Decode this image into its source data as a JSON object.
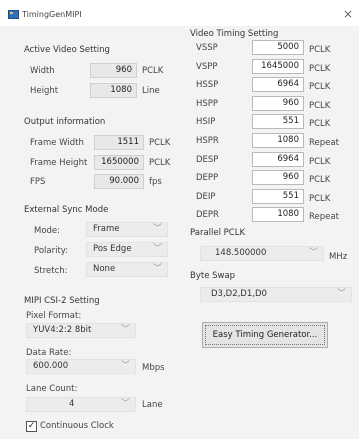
{
  "window": {
    "title": "TimingGenMIPI",
    "close_glyph": "×"
  },
  "active_video": {
    "header": "Active Video Setting",
    "width_label": "Width",
    "width_value": "960",
    "width_unit": "PCLK",
    "height_label": "Height",
    "height_value": "1080",
    "height_unit": "Line"
  },
  "output_info": {
    "header": "Output information",
    "frame_width_label": "Frame Width",
    "frame_width_value": "1511",
    "frame_width_unit": "PCLK",
    "frame_height_label": "Frame Height",
    "frame_height_value": "1650000",
    "frame_height_unit": "PCLK",
    "fps_label": "FPS",
    "fps_value": "90.000",
    "fps_unit": "fps"
  },
  "ext_sync": {
    "header": "External Sync Mode",
    "mode_label": "Mode:",
    "mode_value": "Frame",
    "polarity_label": "Polarity:",
    "polarity_value": "Pos Edge",
    "stretch_label": "Stretch:",
    "stretch_value": "None"
  },
  "mipi": {
    "header": "MIPI CSI-2 Setting",
    "pixel_format_label": "Pixel Format:",
    "pixel_format_value": "YUV4:2:2 8bit",
    "data_rate_label": "Data Rate:",
    "data_rate_value": "600.000",
    "data_rate_unit": "Mbps",
    "lane_count_label": "Lane Count:",
    "lane_count_value": "4",
    "lane_unit": "Lane",
    "continuous_clock_label": "Continuous Clock",
    "continuous_clock_checked": "✓"
  },
  "video_timing": {
    "header": "Video Timing Setting",
    "rows": [
      {
        "label": "VSSP",
        "value": "5000",
        "unit": "PCLK"
      },
      {
        "label": "VSPP",
        "value": "1645000",
        "unit": "PCLK"
      },
      {
        "label": "HSSP",
        "value": "6964",
        "unit": "PCLK"
      },
      {
        "label": "HSPP",
        "value": "960",
        "unit": "PCLK"
      },
      {
        "label": "HSIP",
        "value": "551",
        "unit": "PCLK"
      },
      {
        "label": "HSPR",
        "value": "1080",
        "unit": "Repeat"
      },
      {
        "label": "DESP",
        "value": "6964",
        "unit": "PCLK"
      },
      {
        "label": "DEPP",
        "value": "960",
        "unit": "PCLK"
      },
      {
        "label": "DEIP",
        "value": "551",
        "unit": "PCLK"
      },
      {
        "label": "DEPR",
        "value": "1080",
        "unit": "Repeat"
      }
    ]
  },
  "parallel_pclk": {
    "header": "Parallel PCLK",
    "value": "148.500000",
    "unit": "MHz"
  },
  "byte_swap": {
    "header": "Byte Swap",
    "value": "D3,D2,D1,D0"
  },
  "easy_timing_button": "Easy Timing Generator...",
  "icons": {
    "dropdown": "chevron-down-icon",
    "close": "close-icon",
    "app": "app-icon"
  }
}
